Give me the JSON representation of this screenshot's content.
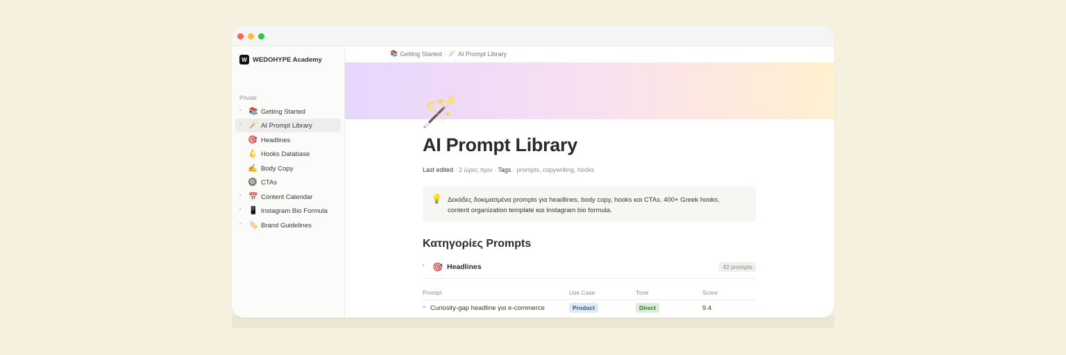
{
  "workspace": {
    "logo_letter": "W",
    "name": "WEDOHYPE Academy"
  },
  "sidebar": {
    "section_label": "Private",
    "items": [
      {
        "emoji": "📚",
        "label": "Getting Started",
        "bullet": "•"
      },
      {
        "emoji": "🪄",
        "label": "AI Prompt Library",
        "bullet": "•",
        "active": true
      },
      {
        "emoji": "🎯",
        "label": "Headlines"
      },
      {
        "emoji": "🪝",
        "label": "Hooks Database"
      },
      {
        "emoji": "✍️",
        "label": "Body Copy"
      },
      {
        "emoji": "🔘",
        "label": "CTAs"
      },
      {
        "emoji": "📅",
        "label": "Content Calendar",
        "bullet": "•"
      },
      {
        "emoji": "📱",
        "label": "Instagram Bio Formula",
        "bullet": "•"
      },
      {
        "emoji": "🏷️",
        "label": "Brand Guidelines",
        "bullet": "•"
      }
    ]
  },
  "breadcrumb": {
    "items": [
      {
        "emoji": "📚",
        "label": "Getting Started"
      },
      {
        "emoji": "🪄",
        "label": "AI Prompt Library"
      }
    ],
    "separator": "·"
  },
  "page": {
    "icon": "🪄",
    "title": "AI Prompt Library",
    "meta": {
      "last_edited_label": "Last edited",
      "last_edited_value": "2 ώρες πριν",
      "tags_label": "Tags",
      "tags_value": "prompts, copywriting, hooks"
    },
    "callout": {
      "icon": "💡",
      "text": "Δεκάδες δοκιμασμένα prompts για headlines, body copy, hooks και CTAs. 400+ Greek hooks, content organization template και Instagram bio formula."
    },
    "section_heading": "Κατηγορίες Prompts",
    "toggle": {
      "emoji": "🎯",
      "label": "Headlines",
      "count": "42 prompts"
    },
    "table": {
      "headers": [
        "Prompt",
        "Use Case",
        "Tone",
        "Score"
      ],
      "rows": [
        {
          "prompt": "Curiosity-gap headline για e-commerce",
          "use_case": "Product",
          "tone": "Direct",
          "score": "9.4"
        }
      ]
    }
  },
  "colors": {
    "background": "#f6f0de",
    "close_dot": "#ff5f57",
    "minimize_dot": "#febc2e",
    "maximize_dot": "#28c840",
    "pill_product": "#dfe9f3",
    "pill_direct": "#dceedb"
  }
}
